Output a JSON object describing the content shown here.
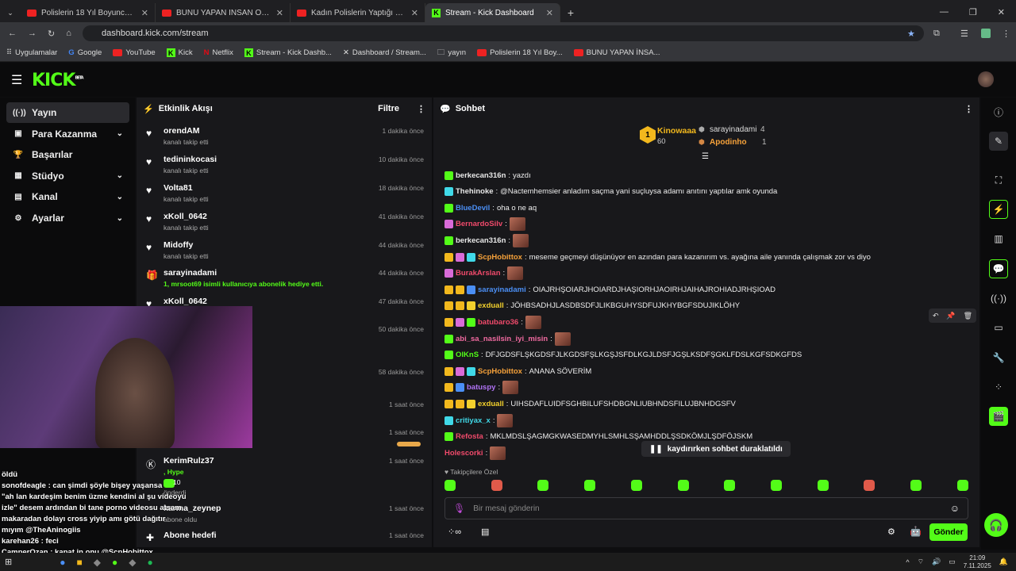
{
  "browser": {
    "tabs": [
      {
        "label": "Polislerin 18 Yıl Boyunca Çözem",
        "kind": "yt"
      },
      {
        "label": "BUNU YAPAN İNSAN OLAMAZ",
        "kind": "yt"
      },
      {
        "label": "Kadın Polislerin Yaptığı ÖLÜMC",
        "kind": "yt"
      },
      {
        "label": "Stream - Kick Dashboard",
        "kind": "kick",
        "active": true
      }
    ],
    "url": "dashboard.kick.com/stream",
    "bookmarks": [
      "Uygulamalar",
      "Google",
      "YouTube",
      "Kick",
      "Netflix",
      "Stream - Kick Dashb...",
      "Dashboard / Stream...",
      "yayın",
      "Polislerin 18 Yıl Boy...",
      "BUNU YAPAN İNSA..."
    ]
  },
  "kick": {
    "logo": "KICK",
    "beta": "BETA"
  },
  "sidebar": {
    "items": [
      {
        "label": "Yayın",
        "icon": "broadcast-icon",
        "glyph": "((·))",
        "active": true
      },
      {
        "label": "Para Kazanma",
        "icon": "money-icon",
        "glyph": "▣",
        "chev": true
      },
      {
        "label": "Başarılar",
        "icon": "trophy-icon",
        "glyph": "🏆"
      },
      {
        "label": "Stüdyo",
        "icon": "studio-icon",
        "glyph": "▦",
        "chev": true
      },
      {
        "label": "Kanal",
        "icon": "channel-icon",
        "glyph": "▤",
        "chev": true
      },
      {
        "label": "Ayarlar",
        "icon": "settings-icon",
        "glyph": "⚙",
        "chev": true
      }
    ]
  },
  "activity": {
    "title": "Etkinlik Akışı",
    "filter": "Filtre",
    "items": [
      {
        "name": "orendAM",
        "sub": "kanalı takip etti",
        "time": "1 dakika önce",
        "icon": "heart"
      },
      {
        "name": "tedininkocasi",
        "sub": "kanalı takip etti",
        "time": "10 dakika önce",
        "icon": "heart"
      },
      {
        "name": "Volta81",
        "sub": "kanalı takip etti",
        "time": "18 dakika önce",
        "icon": "heart"
      },
      {
        "name": "xKoll_0642",
        "sub": "kanalı takip etti",
        "time": "41 dakika önce",
        "icon": "heart"
      },
      {
        "name": "Midoffy",
        "sub": "kanalı takip etti",
        "time": "44 dakika önce",
        "icon": "heart"
      },
      {
        "name": "sarayinadami",
        "sub": "1, mrsoot69 isimli kullanıcıya abonelik hediye etti.",
        "time": "44 dakika önce",
        "icon": "gift"
      },
      {
        "name": "xKoll_0642",
        "sub": "",
        "time": "47 dakika önce",
        "icon": "heart"
      },
      {
        "name": "",
        "sub": "",
        "time": "50 dakika önce",
        "icon": ""
      },
      {
        "name": "",
        "sub": "",
        "time": "58 dakika önce",
        "icon": ""
      },
      {
        "name": "",
        "sub": "",
        "time": "1 saat önce",
        "icon": ""
      },
      {
        "name": "",
        "sub": "",
        "time": "1 saat önce",
        "icon": ""
      },
      {
        "name": "KerimRulz37",
        "sub": ", Hype",
        "time": "1 saat önce",
        "icon": "kick"
      },
      {
        "name": "karma_zeynep",
        "sub": "abone oldu",
        "time": "1 saat önce",
        "icon": ""
      },
      {
        "name": "Abone hedefi",
        "sub": "",
        "time": "1 saat önce",
        "icon": "plus"
      }
    ],
    "hype_count": "10",
    "hype_sub": "önderdi"
  },
  "chat": {
    "title": "Sohbet",
    "leaders": {
      "first": "Kinowaaa",
      "first_count": "60",
      "second": "sarayinadami",
      "second_count": "4",
      "third": "Apodinho",
      "third_count": "1",
      "rank": "1"
    },
    "messages": [
      {
        "user": "berkecan316n",
        "color": "#e8e8e8",
        "text": "yazdı",
        "emote": false
      },
      {
        "user": "Thehinoke",
        "color": "#e8e8e8",
        "text": "@Nactemhemsier anladım saçma yani suçluysa adamı anıtını yaptılar amk oyunda",
        "emote": false
      },
      {
        "user": "BlueDevil",
        "color": "#4b8ff5",
        "text": "oha o ne aq",
        "emote": false
      },
      {
        "user": "BernardoSilv",
        "color": "#f04a6b",
        "text": "",
        "emote": true
      },
      {
        "user": "berkecan316n",
        "color": "#e8e8e8",
        "text": "",
        "emote": true
      },
      {
        "user": "ScpHobittox",
        "color": "#f7a23a",
        "text": "meseme geçmeyi düşünüyor en azından para kazanırım vs. ayağına aile yanında çalışmak zor vs diyo",
        "emote": false
      },
      {
        "user": "BurakArslan",
        "color": "#f04a6b",
        "text": "",
        "emote": true
      },
      {
        "user": "sarayinadami",
        "color": "#4b8ff5",
        "text": "OIAJRHŞOIARJHOIARDJHAŞIORHJAOIRHJAIHAJROHIADJRHŞIOAD",
        "emote": false
      },
      {
        "user": "exduall",
        "color": "#f2d02d",
        "text": "JÖHBSADHJLASDBSDFJLIKBGUHYSDFUJKHYBGFSDUJIKLÖHY",
        "emote": false
      },
      {
        "user": "batubaro36",
        "color": "#f04a6b",
        "text": "",
        "emote": true
      },
      {
        "user": "abi_sa_nasilsin_iyi_misin",
        "color": "#f06aa0",
        "text": "",
        "emote": true
      },
      {
        "user": "OlKnS",
        "color": "#53fc18",
        "text": "DFJGDSFLŞKGDSFJLKGDSFŞLKGŞJSFDLKGJLDSFJGŞLKSDFŞGKLFDSLKGFSDKGFDS",
        "emote": false
      },
      {
        "user": "ScpHobittox",
        "color": "#f7a23a",
        "text": "ANANA SÖVERİM",
        "emote": false
      },
      {
        "user": "batuspy",
        "color": "#b073f5",
        "text": "",
        "emote": true
      },
      {
        "user": "exduall",
        "color": "#f2d02d",
        "text": "UIHSDAFLUIDFSGHBILUFSHDBGNLIUBHNDSFILUJBNHDGSFV",
        "emote": false
      },
      {
        "user": "critiyax_x",
        "color": "#40d9e8",
        "text": "",
        "emote": true
      },
      {
        "user": "Refosta",
        "color": "#f04a6b",
        "text": "MKLMDSLŞAGMGKWASEDMYHLSMHLSŞAMHDDLŞSDKÖMJLŞDFÖJSKM",
        "emote": false
      },
      {
        "user": "Holescorki",
        "color": "#f04a6b",
        "text": "",
        "emote": true
      }
    ],
    "paused": "kaydırırken sohbet duraklatıldı",
    "followers_only": "Takipçilere Özel",
    "placeholder": "Bir mesaj gönderin",
    "send": "Gönder"
  },
  "overlay": {
    "lines": [
      "öldü",
      "sonofdeagle : can şimdi şöyle bişey yaşansa",
      "\"ah lan kardeşim benim üzme kendini al şu videoyu",
      "izle\" desem ardından bi tane porno videosu atsam",
      "makaradan dolayı cross yiyip amı götü dağıtır",
      "mıyım @TheAninogiis",
      "karehan26 : feci",
      "CamperOzan : kapat in onu @ScpHobittox"
    ]
  },
  "taskbar": {
    "time": "21:09",
    "date": "7.11.2025"
  }
}
